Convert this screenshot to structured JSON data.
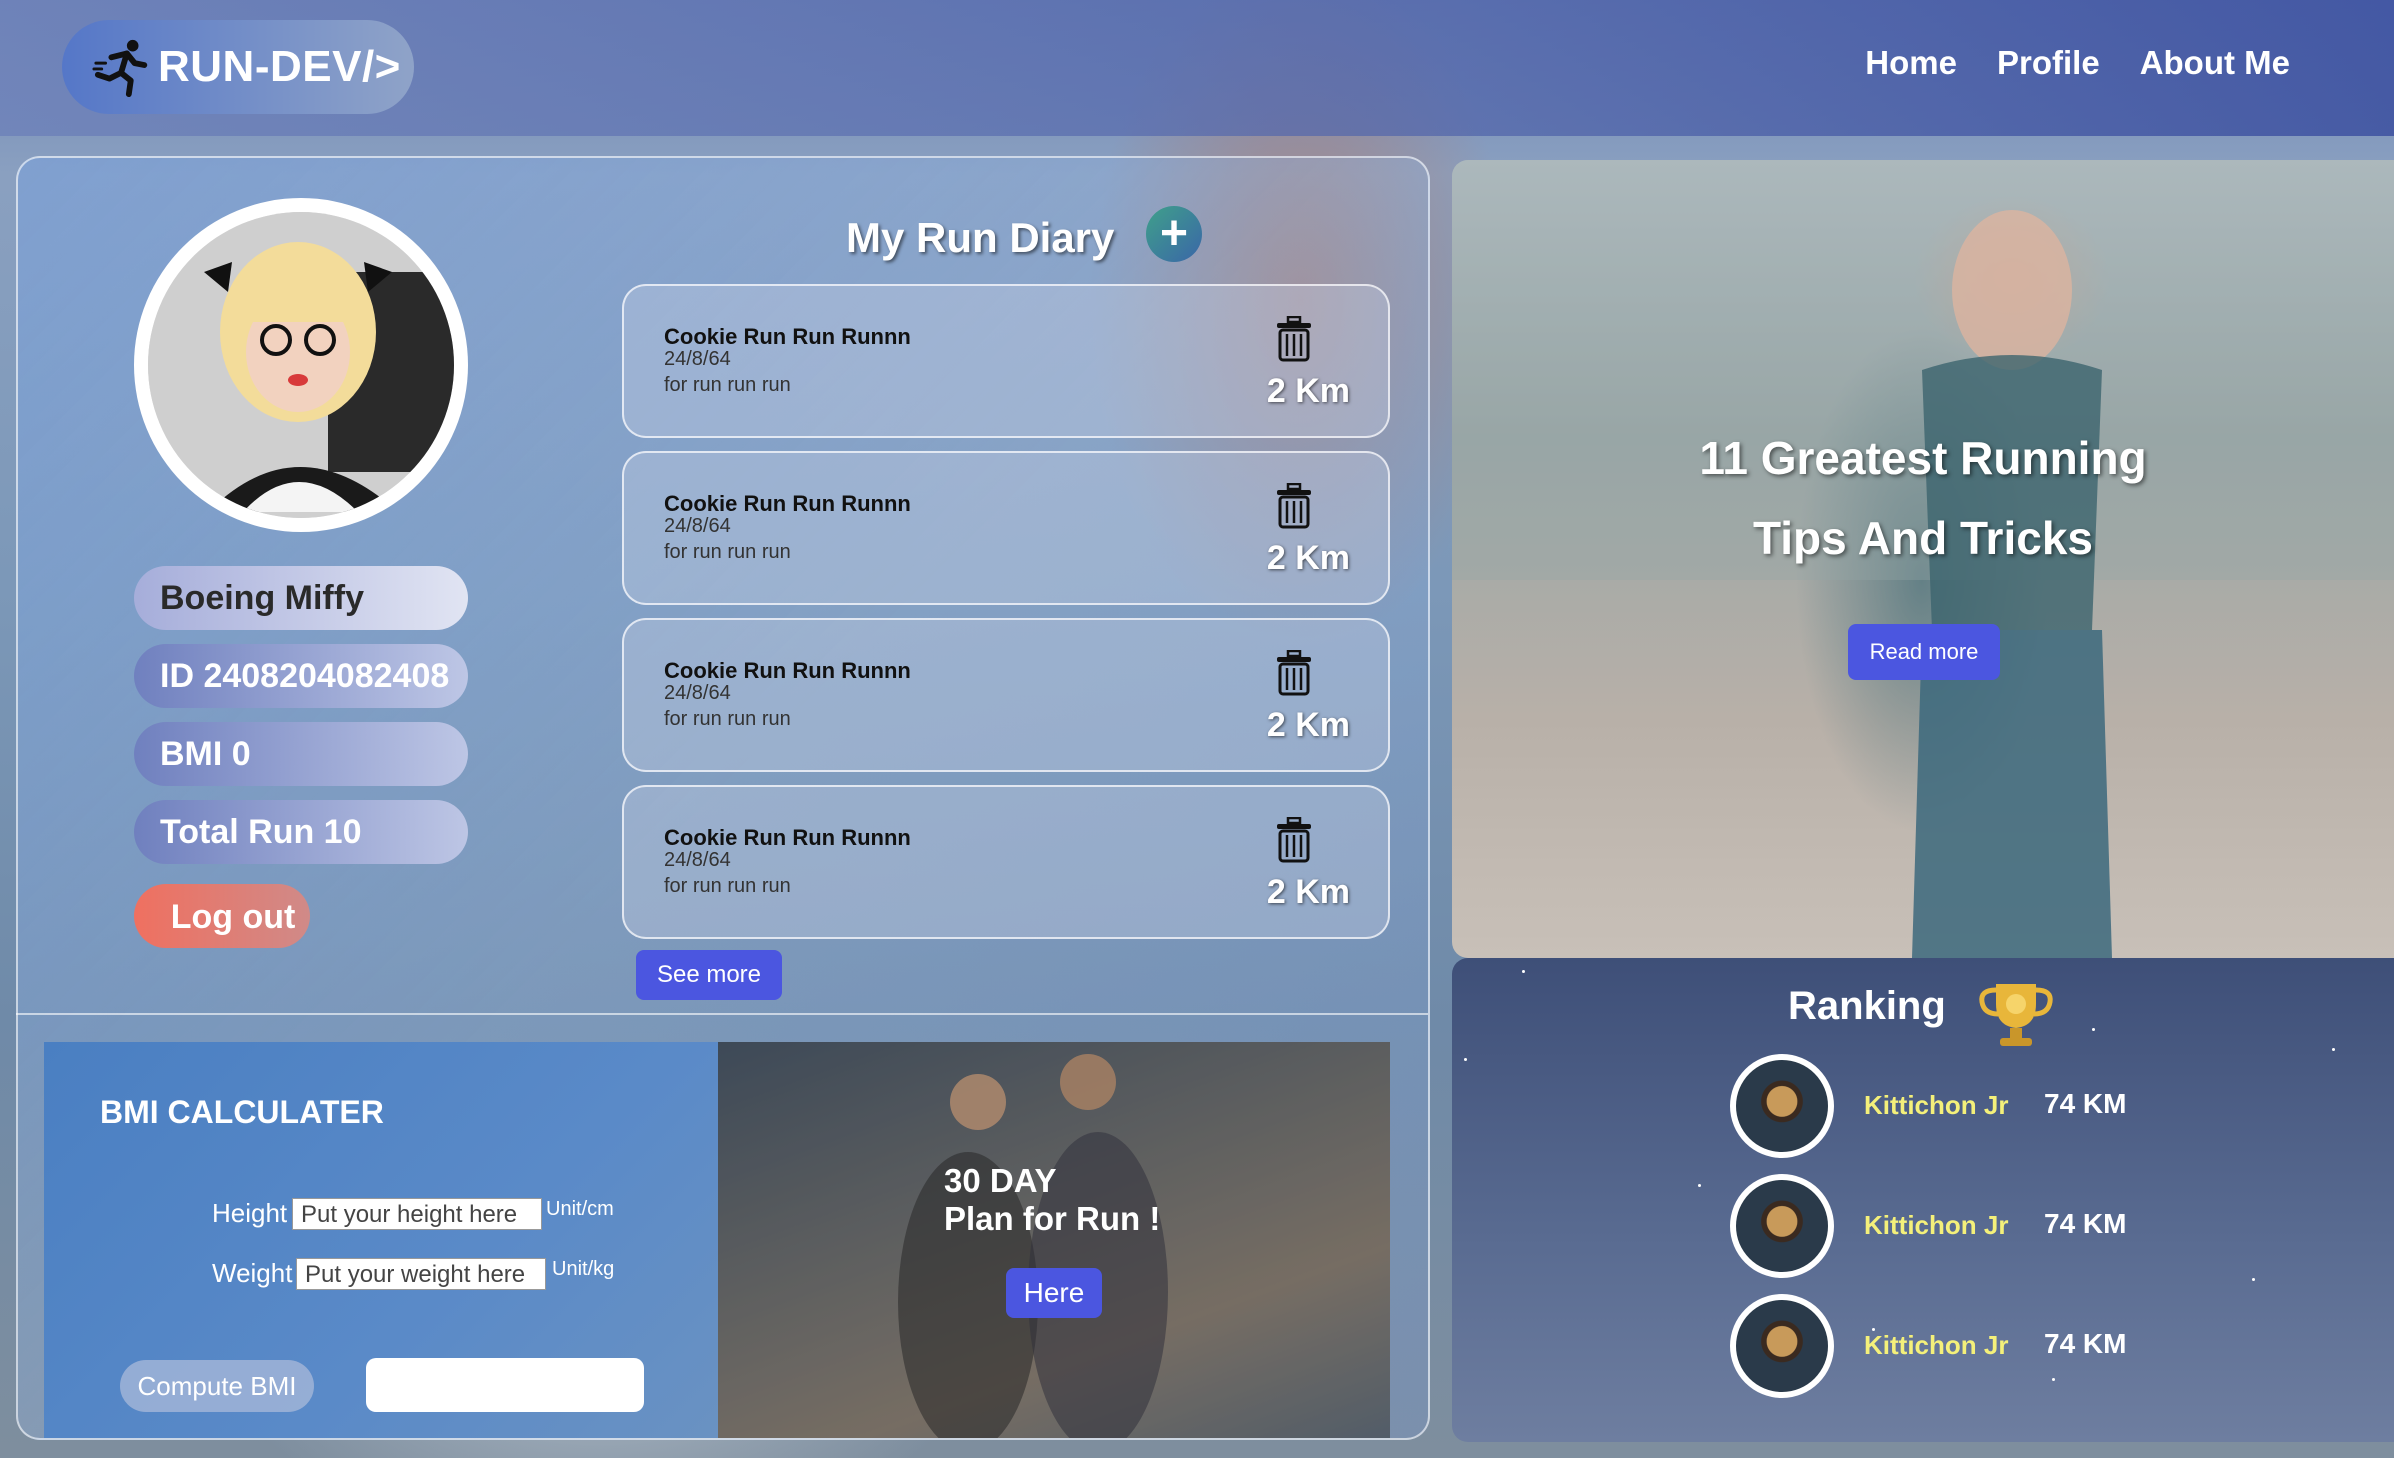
{
  "header": {
    "logo_text": "RUN-DEV/>",
    "nav": [
      "Home",
      "Profile",
      "About Me"
    ]
  },
  "profile": {
    "name": "Boeing Miffy",
    "id_label": "ID 2408204082408",
    "bmi_label": "BMI 0",
    "total_run_label": "Total Run 10",
    "logout_label": "Log out"
  },
  "diary": {
    "title": "My Run Diary",
    "add_symbol": "+",
    "entries": [
      {
        "title": "Cookie Run Run Runnn",
        "date": "24/8/64",
        "note": "for run run run",
        "distance": "2 Km"
      },
      {
        "title": "Cookie Run Run Runnn",
        "date": "24/8/64",
        "note": "for run run run",
        "distance": "2 Km"
      },
      {
        "title": "Cookie Run Run Runnn",
        "date": "24/8/64",
        "note": "for run run run",
        "distance": "2 Km"
      },
      {
        "title": "Cookie Run Run Runnn",
        "date": "24/8/64",
        "note": "for run run run",
        "distance": "2 Km"
      }
    ],
    "see_more_label": "See more"
  },
  "bmi": {
    "title": "BMI CALCULATER",
    "height_label": "Height",
    "height_placeholder": "Put your height here",
    "height_unit": "Unit/cm",
    "weight_label": "Weight",
    "weight_placeholder": "Put your weight here",
    "weight_unit": "Unit/kg",
    "compute_label": "Compute BMI",
    "result_value": ""
  },
  "plan": {
    "line1": "30 DAY",
    "line2": "Plan for Run !",
    "button_label": "Here"
  },
  "hero": {
    "line1": "11 Greatest Running",
    "line2": "Tips And Tricks",
    "button_label": "Read more"
  },
  "ranking": {
    "title": "Ranking",
    "rows": [
      {
        "name": "Kittichon Jr",
        "distance": "74 KM"
      },
      {
        "name": "Kittichon Jr",
        "distance": "74 KM"
      },
      {
        "name": "Kittichon Jr",
        "distance": "74 KM"
      }
    ]
  },
  "colors": {
    "accent_button": "#4b56e0",
    "logout": "#ef7060",
    "rank_name": "#f4f07a"
  },
  "icons": [
    "runner-icon",
    "plus-icon",
    "trash-icon",
    "trophy-icon"
  ]
}
